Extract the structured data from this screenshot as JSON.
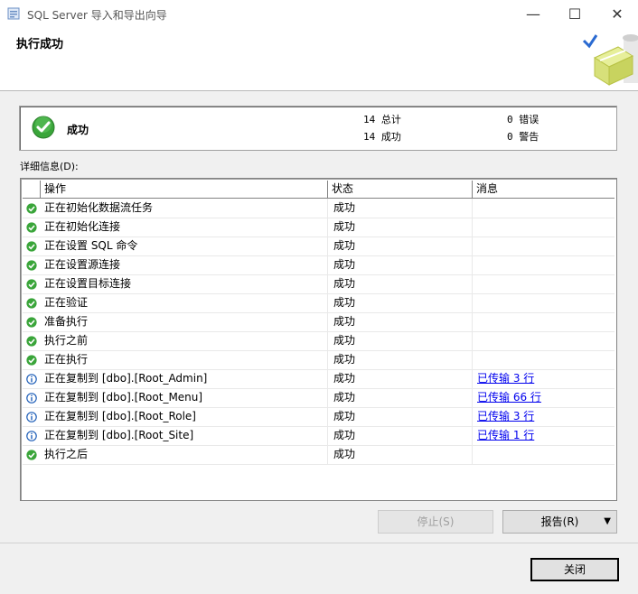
{
  "window": {
    "title": "SQL Server 导入和导出向导",
    "minimize": "—",
    "maximize": "☐",
    "close": "✕"
  },
  "header": {
    "title": "执行成功"
  },
  "summary": {
    "status": "成功",
    "total_line": "14 总计",
    "success_line": "14 成功",
    "error_line": "0 错误",
    "warning_line": "0 警告"
  },
  "details": {
    "label": "详细信息(D):",
    "columns": [
      "操作",
      "状态",
      "消息"
    ],
    "rows": [
      {
        "icon": "success-icon",
        "operation": "正在初始化数据流任务",
        "status": "成功",
        "message": ""
      },
      {
        "icon": "success-icon",
        "operation": "正在初始化连接",
        "status": "成功",
        "message": ""
      },
      {
        "icon": "success-icon",
        "operation": "正在设置 SQL 命令",
        "status": "成功",
        "message": ""
      },
      {
        "icon": "success-icon",
        "operation": "正在设置源连接",
        "status": "成功",
        "message": ""
      },
      {
        "icon": "success-icon",
        "operation": "正在设置目标连接",
        "status": "成功",
        "message": ""
      },
      {
        "icon": "success-icon",
        "operation": "正在验证",
        "status": "成功",
        "message": ""
      },
      {
        "icon": "success-icon",
        "operation": "准备执行",
        "status": "成功",
        "message": ""
      },
      {
        "icon": "success-icon",
        "operation": "执行之前",
        "status": "成功",
        "message": ""
      },
      {
        "icon": "success-icon",
        "operation": "正在执行",
        "status": "成功",
        "message": ""
      },
      {
        "icon": "info-icon",
        "operation": "正在复制到 [dbo].[Root_Admin]",
        "status": "成功",
        "message": "已传输 3 行"
      },
      {
        "icon": "info-icon",
        "operation": "正在复制到 [dbo].[Root_Menu]",
        "status": "成功",
        "message": "已传输 66 行"
      },
      {
        "icon": "info-icon",
        "operation": "正在复制到 [dbo].[Root_Role]",
        "status": "成功",
        "message": "已传输 3 行"
      },
      {
        "icon": "info-icon",
        "operation": "正在复制到 [dbo].[Root_Site]",
        "status": "成功",
        "message": "已传输 1 行"
      },
      {
        "icon": "success-icon",
        "operation": "执行之后",
        "status": "成功",
        "message": ""
      }
    ]
  },
  "buttons": {
    "stop": "停止(S)",
    "report": "报告(R)",
    "report_arrow": "▼",
    "close": "关闭"
  },
  "colors": {
    "success_green": "#3aa53a",
    "info_blue": "#1f5fb8",
    "link": "#0000ee",
    "accent_check": "#2a6ad1"
  }
}
